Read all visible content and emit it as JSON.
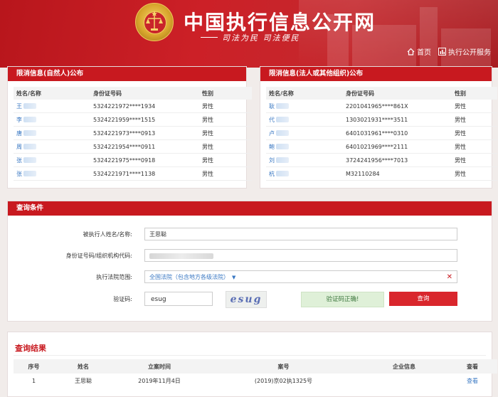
{
  "header": {
    "site_title": "中国执行信息公开网",
    "slogan": "司法为民  司法便民",
    "nav": {
      "home": "首页",
      "service": "执行公开服务"
    }
  },
  "natural_panel": {
    "title": "限消信息(自然人)公布",
    "columns": [
      "姓名/名称",
      "身份证号码",
      "性别"
    ],
    "rows": [
      {
        "name": "王",
        "id": "5324221972****1934",
        "gender": "男性",
        "faded": true
      },
      {
        "name": "李",
        "id": "5324221959****1515",
        "gender": "男性"
      },
      {
        "name": "唐",
        "id": "5324221973****0913",
        "gender": "男性"
      },
      {
        "name": "周",
        "id": "5324221954****0911",
        "gender": "男性"
      },
      {
        "name": "张",
        "id": "5324221975****0918",
        "gender": "男性"
      },
      {
        "name": "张",
        "id": "5324221971****1138",
        "gender": "男性"
      }
    ]
  },
  "legal_panel": {
    "title": "限消信息(法人或其他组织)公布",
    "columns": [
      "姓名/名称",
      "身份证号码",
      "性别"
    ],
    "rows": [
      {
        "name": "耿",
        "id": "2201041965****861X",
        "gender": "男性",
        "faded": true
      },
      {
        "name": "代",
        "id": "1303021931****3511",
        "gender": "男性"
      },
      {
        "name": "卢",
        "id": "6401031961****0310",
        "gender": "男性"
      },
      {
        "name": "鲍",
        "id": "6401021969****2111",
        "gender": "男性"
      },
      {
        "name": "刘",
        "id": "3724241956****7013",
        "gender": "男性"
      },
      {
        "name": "杭",
        "id": "M32110284",
        "gender": "男性"
      }
    ]
  },
  "query": {
    "title": "查询条件",
    "name_label": "被执行人姓名/名称:",
    "name_value": "王思聪",
    "id_label": "身份证号码/组织机构代码:",
    "court_label": "执行法院范围:",
    "court_value": "全国法院（包含地方各级法院）",
    "captcha_label": "验证码:",
    "captcha_value": "esug",
    "captcha_image_text": "esug",
    "verify_message": "验证码正确!",
    "search_button": "查询"
  },
  "results": {
    "title": "查询结果",
    "columns": [
      "序号",
      "姓名",
      "立案时间",
      "案号",
      "企业信息",
      "查看"
    ],
    "rows": [
      {
        "index": "1",
        "name": "王思聪",
        "date": "2019年11月4日",
        "case_no": "(2019)京02执1325号",
        "company": "",
        "view": "查看"
      }
    ]
  },
  "colors": {
    "brand_red": "#c8191f",
    "link_blue": "#3a78c3",
    "success_green": "#dff0d8"
  }
}
